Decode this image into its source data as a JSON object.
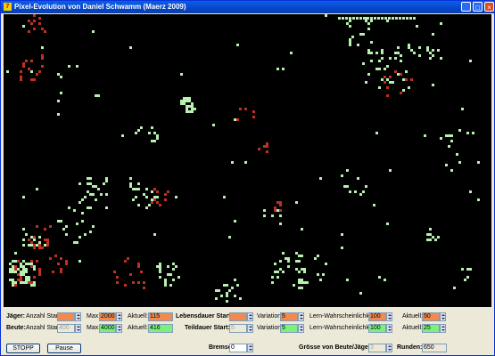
{
  "window": {
    "title": "Pixel-Evolution von Daniel Schwamm (Maerz 2009)",
    "icon_letter": "7",
    "buttons": {
      "minimize": "_",
      "maximize": "□",
      "close": "×"
    }
  },
  "colors": {
    "hunter": "#C03020",
    "prey": "#B8F0B0",
    "hunter_field": "#F08A50",
    "prey_field": "#7CF07C",
    "canvas_bg": "#000000"
  },
  "controls": {
    "jaeger": {
      "label": "Jäger:",
      "anzahl_start_label": "Anzahl Start:",
      "anzahl_start_value": "",
      "max_label": "Max:",
      "max_value": "2000",
      "aktuell_label": "Aktuell:",
      "aktuell_value": "115",
      "lebensdauer_label": "Lebensdauer Start:",
      "lebensdauer_value": "",
      "variation_label": "Variation:",
      "variation_value": "5",
      "lern_label": "Lern-Wahrscheinlichkeit:",
      "lern_value": "100",
      "aktuell2_label": "Aktuell:",
      "aktuell2_value": "50"
    },
    "beute": {
      "label": "Beute:",
      "anzahl_start_label": "Anzahl Start:",
      "anzahl_start_value": "400",
      "max_label": "Max:",
      "max_value": "4000",
      "aktuell_label": "Aktuell:",
      "aktuell_value": "416",
      "teildauer_label": "Teildauer Start:",
      "teildauer_value": "5",
      "variation_label": "Variation:",
      "variation_value": "5",
      "lern_label": "Lern-Wahrscheinlichkeit:",
      "lern_value": "100",
      "aktuell2_label": "Aktuell:",
      "aktuell2_value": "25"
    },
    "bremse_label": "Bremse:",
    "bremse_value": "0",
    "groesse_label": "Grösse von Beute/Jäger:",
    "groesse_value": "3",
    "runden_label": "Runden:",
    "runden_value": "650",
    "stopp_label": "STOPP",
    "pause_label": "Pause"
  }
}
